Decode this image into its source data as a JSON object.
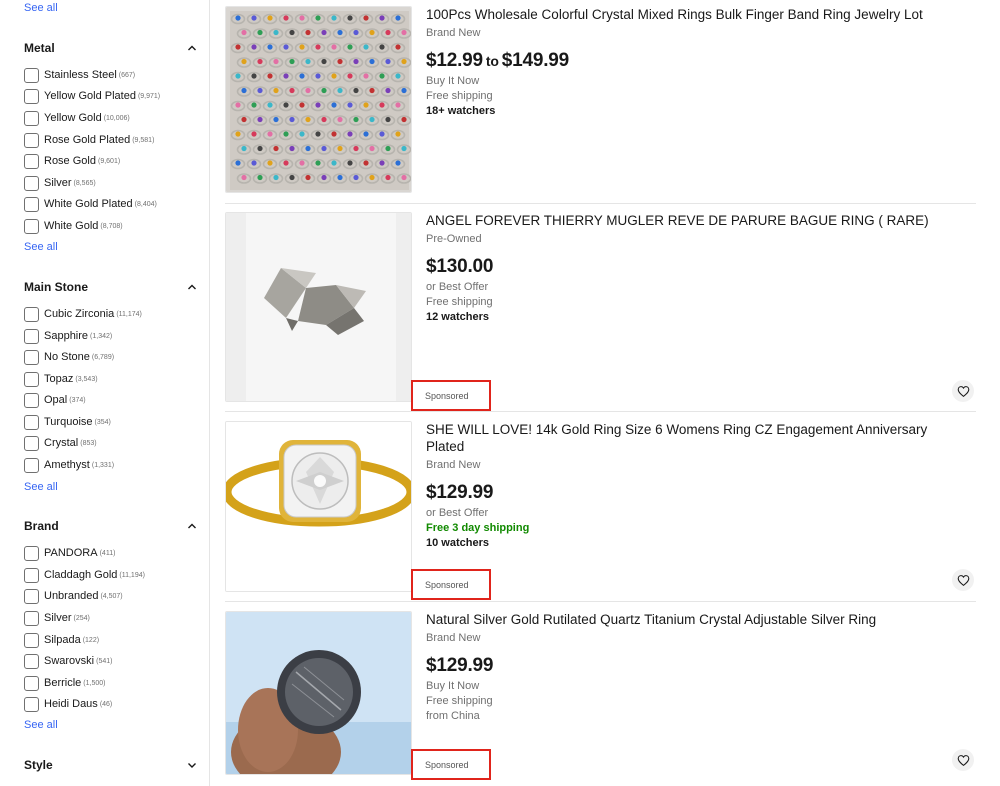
{
  "sidebar": {
    "top_see_all": "See all",
    "metal": {
      "title": "Metal",
      "options": [
        {
          "label": "Stainless Steel",
          "count": "(667)"
        },
        {
          "label": "Yellow Gold Plated",
          "count": "(9,971)"
        },
        {
          "label": "Yellow Gold",
          "count": "(10,006)"
        },
        {
          "label": "Rose Gold Plated",
          "count": "(9,581)"
        },
        {
          "label": "Rose Gold",
          "count": "(9,601)"
        },
        {
          "label": "Silver",
          "count": "(8,565)"
        },
        {
          "label": "White Gold Plated",
          "count": "(8,404)"
        },
        {
          "label": "White Gold",
          "count": "(8,708)"
        }
      ],
      "see_all": "See all"
    },
    "main_stone": {
      "title": "Main Stone",
      "options": [
        {
          "label": "Cubic Zirconia",
          "count": "(11,174)"
        },
        {
          "label": "Sapphire",
          "count": "(1,342)"
        },
        {
          "label": "No Stone",
          "count": "(6,789)"
        },
        {
          "label": "Topaz",
          "count": "(3,543)"
        },
        {
          "label": "Opal",
          "count": "(374)"
        },
        {
          "label": "Turquoise",
          "count": "(354)"
        },
        {
          "label": "Crystal",
          "count": "(853)"
        },
        {
          "label": "Amethyst",
          "count": "(1,331)"
        }
      ],
      "see_all": "See all"
    },
    "brand": {
      "title": "Brand",
      "options": [
        {
          "label": "PANDORA",
          "count": "(411)"
        },
        {
          "label": "Claddagh Gold",
          "count": "(11,194)"
        },
        {
          "label": "Unbranded",
          "count": "(4,507)"
        },
        {
          "label": "Silver",
          "count": "(254)"
        },
        {
          "label": "Silpada",
          "count": "(122)"
        },
        {
          "label": "Swarovski",
          "count": "(541)"
        },
        {
          "label": "Berricle",
          "count": "(1,500)"
        },
        {
          "label": "Heidi Daus",
          "count": "(46)"
        }
      ],
      "see_all": "See all"
    },
    "style": {
      "title": "Style"
    }
  },
  "listings": [
    {
      "title": "100Pcs Wholesale Colorful Crystal Mixed Rings Bulk Finger Band Ring Jewelry Lot",
      "condition": "Brand New",
      "price_low": "$12.99",
      "price_to": "to",
      "price_high": "$149.99",
      "format": "Buy It Now",
      "shipping": "Free shipping",
      "watchers": "18+ watchers"
    },
    {
      "title": "ANGEL FOREVER THIERRY MUGLER REVE DE PARURE BAGUE RING ( RARE)",
      "condition": "Pre-Owned",
      "price": "$130.00",
      "format": "or Best Offer",
      "shipping": "Free shipping",
      "watchers": "12 watchers",
      "sponsored": "Sponsored"
    },
    {
      "title": "SHE WILL LOVE! 14k Gold Ring Size 6 Womens Ring CZ Engagement Anniversary Plated",
      "condition": "Brand New",
      "price": "$129.99",
      "format": "or Best Offer",
      "shipping": "Free 3 day shipping",
      "watchers": "10 watchers",
      "sponsored": "Sponsored"
    },
    {
      "title": "Natural Silver Gold Rutilated Quartz Titanium Crystal Adjustable Silver Ring",
      "condition": "Brand New",
      "price": "$129.99",
      "format": "Buy It Now",
      "shipping": "Free shipping",
      "origin": "from China",
      "sponsored": "Sponsored"
    }
  ],
  "icons": {
    "chevron_up": "chevron-up-icon",
    "chevron_down": "chevron-down-icon",
    "heart": "heart-icon"
  },
  "colors": {
    "link": "#3665f3",
    "shipping_green": "#118a00",
    "highlight_red": "#e0241b"
  }
}
